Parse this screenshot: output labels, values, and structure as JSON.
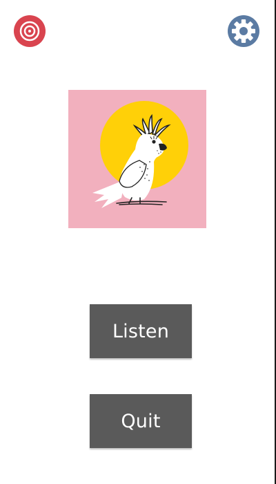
{
  "header": {
    "left_icon": "target-icon",
    "right_icon": "gear-icon"
  },
  "artwork": {
    "subject": "cockatoo-illustration",
    "background_color": "#F2B0BE",
    "sun_color": "#FFD008"
  },
  "actions": {
    "listen_label": "Listen",
    "quit_label": "Quit"
  },
  "colors": {
    "target_red": "#D9444F",
    "gear_blue": "#5B7BA3",
    "button_bg": "#5A5A5A",
    "button_text": "#FFFFFF",
    "page_bg": "#FFFFFF"
  }
}
